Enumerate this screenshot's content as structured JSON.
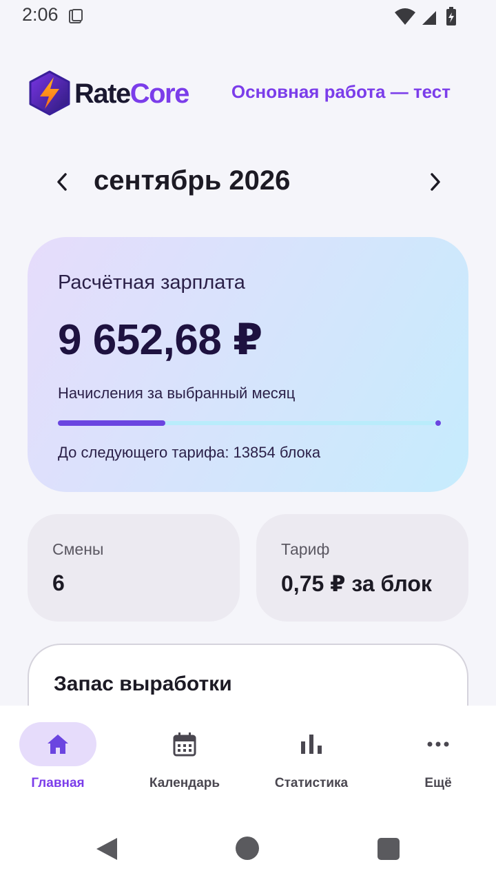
{
  "status_bar": {
    "time": "2:06"
  },
  "header": {
    "logo_part1": "Rate",
    "logo_part2": "Core",
    "workspace": "Основная работа — тест"
  },
  "month_nav": {
    "title": "сентябрь 2026"
  },
  "salary": {
    "label": "Расчётная зарплата",
    "amount": "9 652,68 ₽",
    "subtitle": "Начисления за выбранный месяц",
    "progress_fraction": 0.28,
    "next_tariff": "До следующего тарифа: 13854 блока"
  },
  "stats": {
    "shifts_label": "Смены",
    "shifts_value": "6",
    "tariff_label": "Тариф",
    "tariff_value": "0,75 ₽ за блок"
  },
  "reserve": {
    "title": "Запас выработки"
  },
  "bottom_nav": {
    "items": [
      {
        "label": "Главная",
        "icon": "home-icon",
        "active": true
      },
      {
        "label": "Календарь",
        "icon": "calendar-icon",
        "active": false
      },
      {
        "label": "Статистика",
        "icon": "bar-chart-icon",
        "active": false
      },
      {
        "label": "Ещё",
        "icon": "more-icon",
        "active": false
      }
    ]
  },
  "colors": {
    "accent": "#7b3dea",
    "progress": "#6b45e0",
    "background": "#f5f5fa",
    "active_pill": "#e6dcfb"
  }
}
